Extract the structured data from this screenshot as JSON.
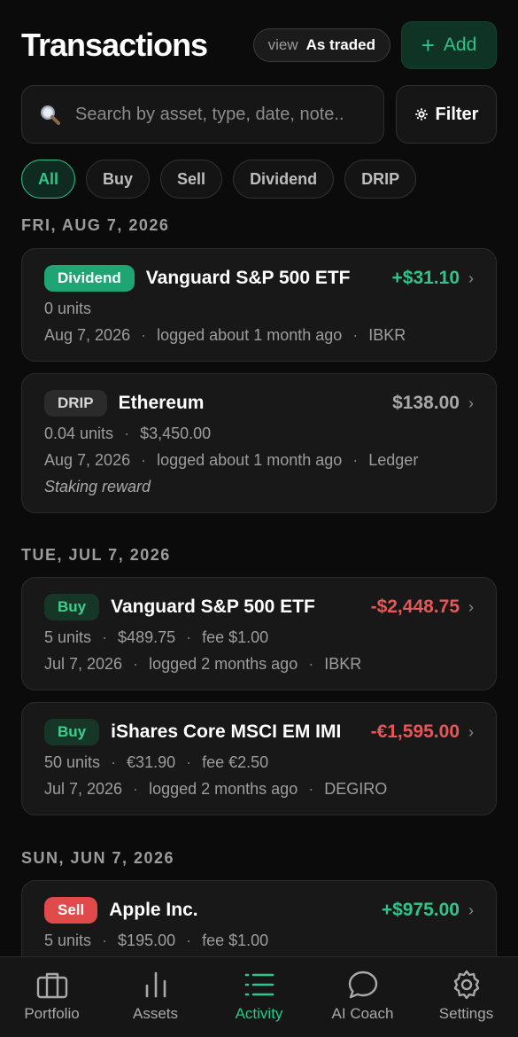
{
  "header": {
    "title": "Transactions",
    "view_label": "view",
    "view_value": "As traded",
    "add_label": "Add"
  },
  "search": {
    "placeholder": "Search by asset, type, date, note..",
    "filter_label": "Filter"
  },
  "chips": [
    "All",
    "Buy",
    "Sell",
    "Dividend",
    "DRIP"
  ],
  "active_chip": "All",
  "groups": [
    {
      "date": "FRI, AUG 7, 2026",
      "transactions": [
        {
          "type": "Dividend",
          "asset": "Vanguard S&P 500 ETF",
          "amount": "+$31.10",
          "units": "0 units",
          "date": "Aug 7, 2026",
          "logged": "logged about 1 month ago",
          "broker": "IBKR"
        },
        {
          "type": "DRIP",
          "asset": "Ethereum",
          "amount": "$138.00",
          "units": "0.04 units",
          "price": "$3,450.00",
          "date": "Aug 7, 2026",
          "logged": "logged about 1 month ago",
          "broker": "Ledger",
          "note": "Staking reward"
        }
      ]
    },
    {
      "date": "TUE, JUL 7, 2026",
      "transactions": [
        {
          "type": "Buy",
          "asset": "Vanguard S&P 500 ETF",
          "amount": "-$2,448.75",
          "units": "5 units",
          "price": "$489.75",
          "fee": "fee $1.00",
          "date": "Jul 7, 2026",
          "logged": "logged 2 months ago",
          "broker": "IBKR"
        },
        {
          "type": "Buy",
          "asset": "iShares Core MSCI EM IMI",
          "amount": "-€1,595.00",
          "units": "50 units",
          "price": "€31.90",
          "fee": "fee €2.50",
          "date": "Jul 7, 2026",
          "logged": "logged 2 months ago",
          "broker": "DEGIRO"
        }
      ]
    },
    {
      "date": "SUN, JUN 7, 2026",
      "transactions": [
        {
          "type": "Sell",
          "asset": "Apple Inc.",
          "amount": "+$975.00",
          "units": "5 units",
          "price": "$195.00",
          "fee": "fee $1.00"
        }
      ]
    }
  ],
  "nav": [
    {
      "label": "Portfolio",
      "icon": "briefcase-icon"
    },
    {
      "label": "Assets",
      "icon": "bar-chart-icon"
    },
    {
      "label": "Activity",
      "icon": "list-icon"
    },
    {
      "label": "AI Coach",
      "icon": "chat-bubble-icon"
    },
    {
      "label": "Settings",
      "icon": "gear-icon"
    }
  ],
  "active_nav": "Activity",
  "colors": {
    "accent": "#2fc48a",
    "negative": "#e85656",
    "background": "#0b0b0b"
  }
}
